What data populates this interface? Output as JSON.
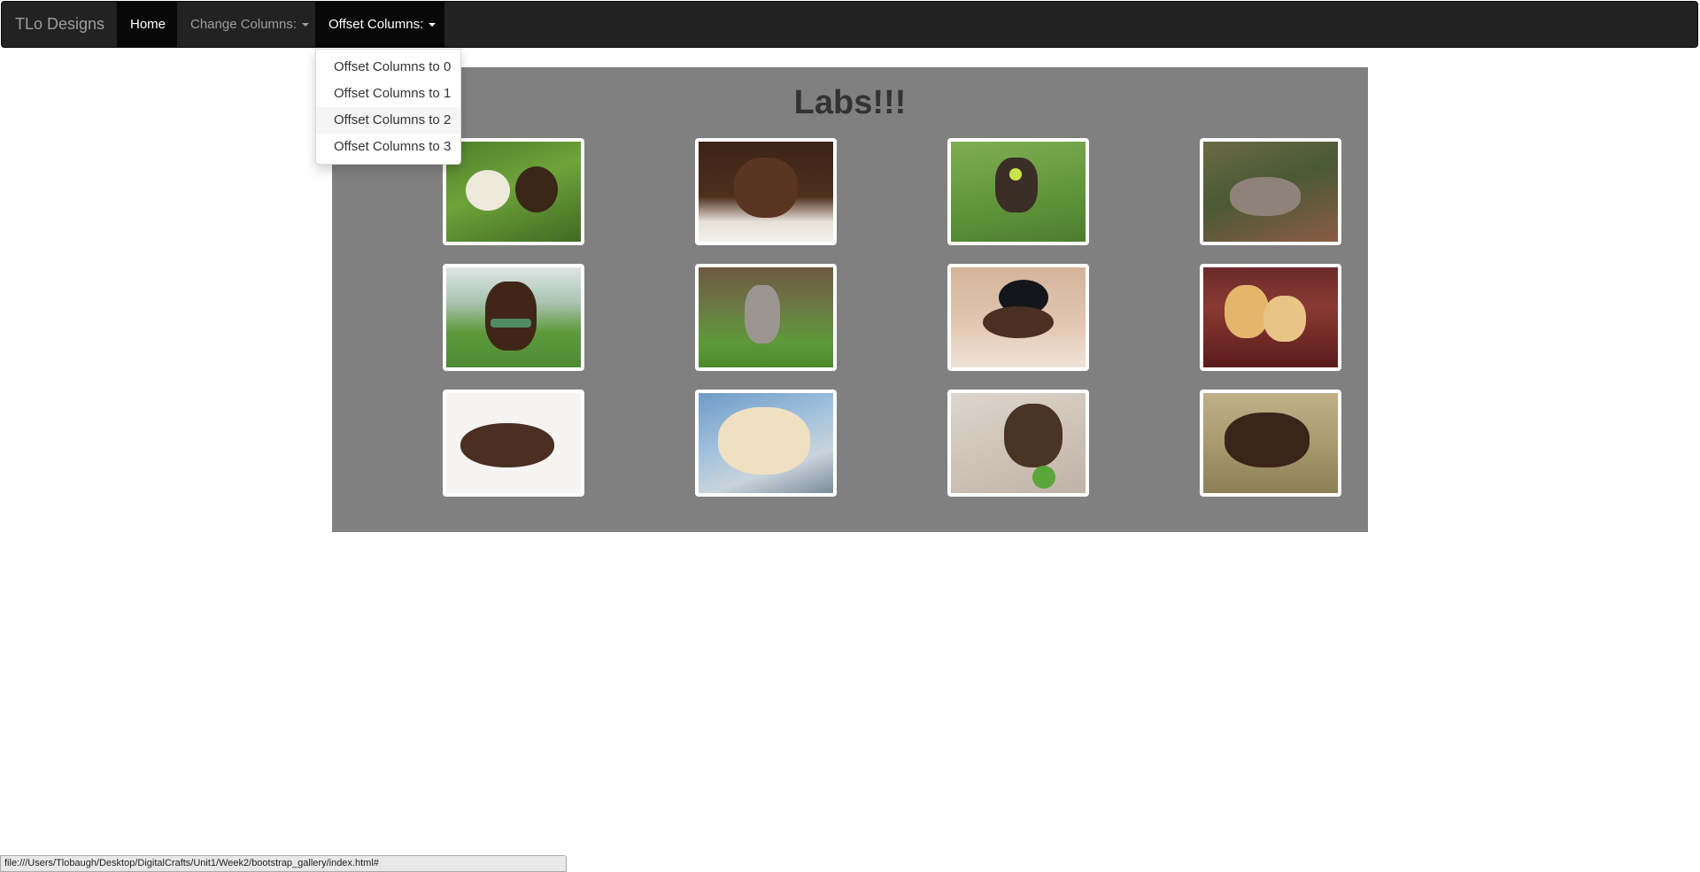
{
  "navbar": {
    "brand": "TLo Designs",
    "items": [
      {
        "label": "Home"
      },
      {
        "label": "Change Columns:"
      },
      {
        "label": "Offset Columns:"
      }
    ]
  },
  "dropdown": {
    "items": [
      {
        "label": "Offset Columns to 0"
      },
      {
        "label": "Offset Columns to 1"
      },
      {
        "label": "Offset Columns to 2"
      },
      {
        "label": "Offset Columns to 3"
      }
    ]
  },
  "gallery": {
    "title": "Labs!!!",
    "background": "#808080"
  },
  "status_bar": {
    "url": "file:///Users/Tlobaugh/Desktop/DigitalCrafts/Unit1/Week2/bootstrap_gallery/index.html#"
  }
}
